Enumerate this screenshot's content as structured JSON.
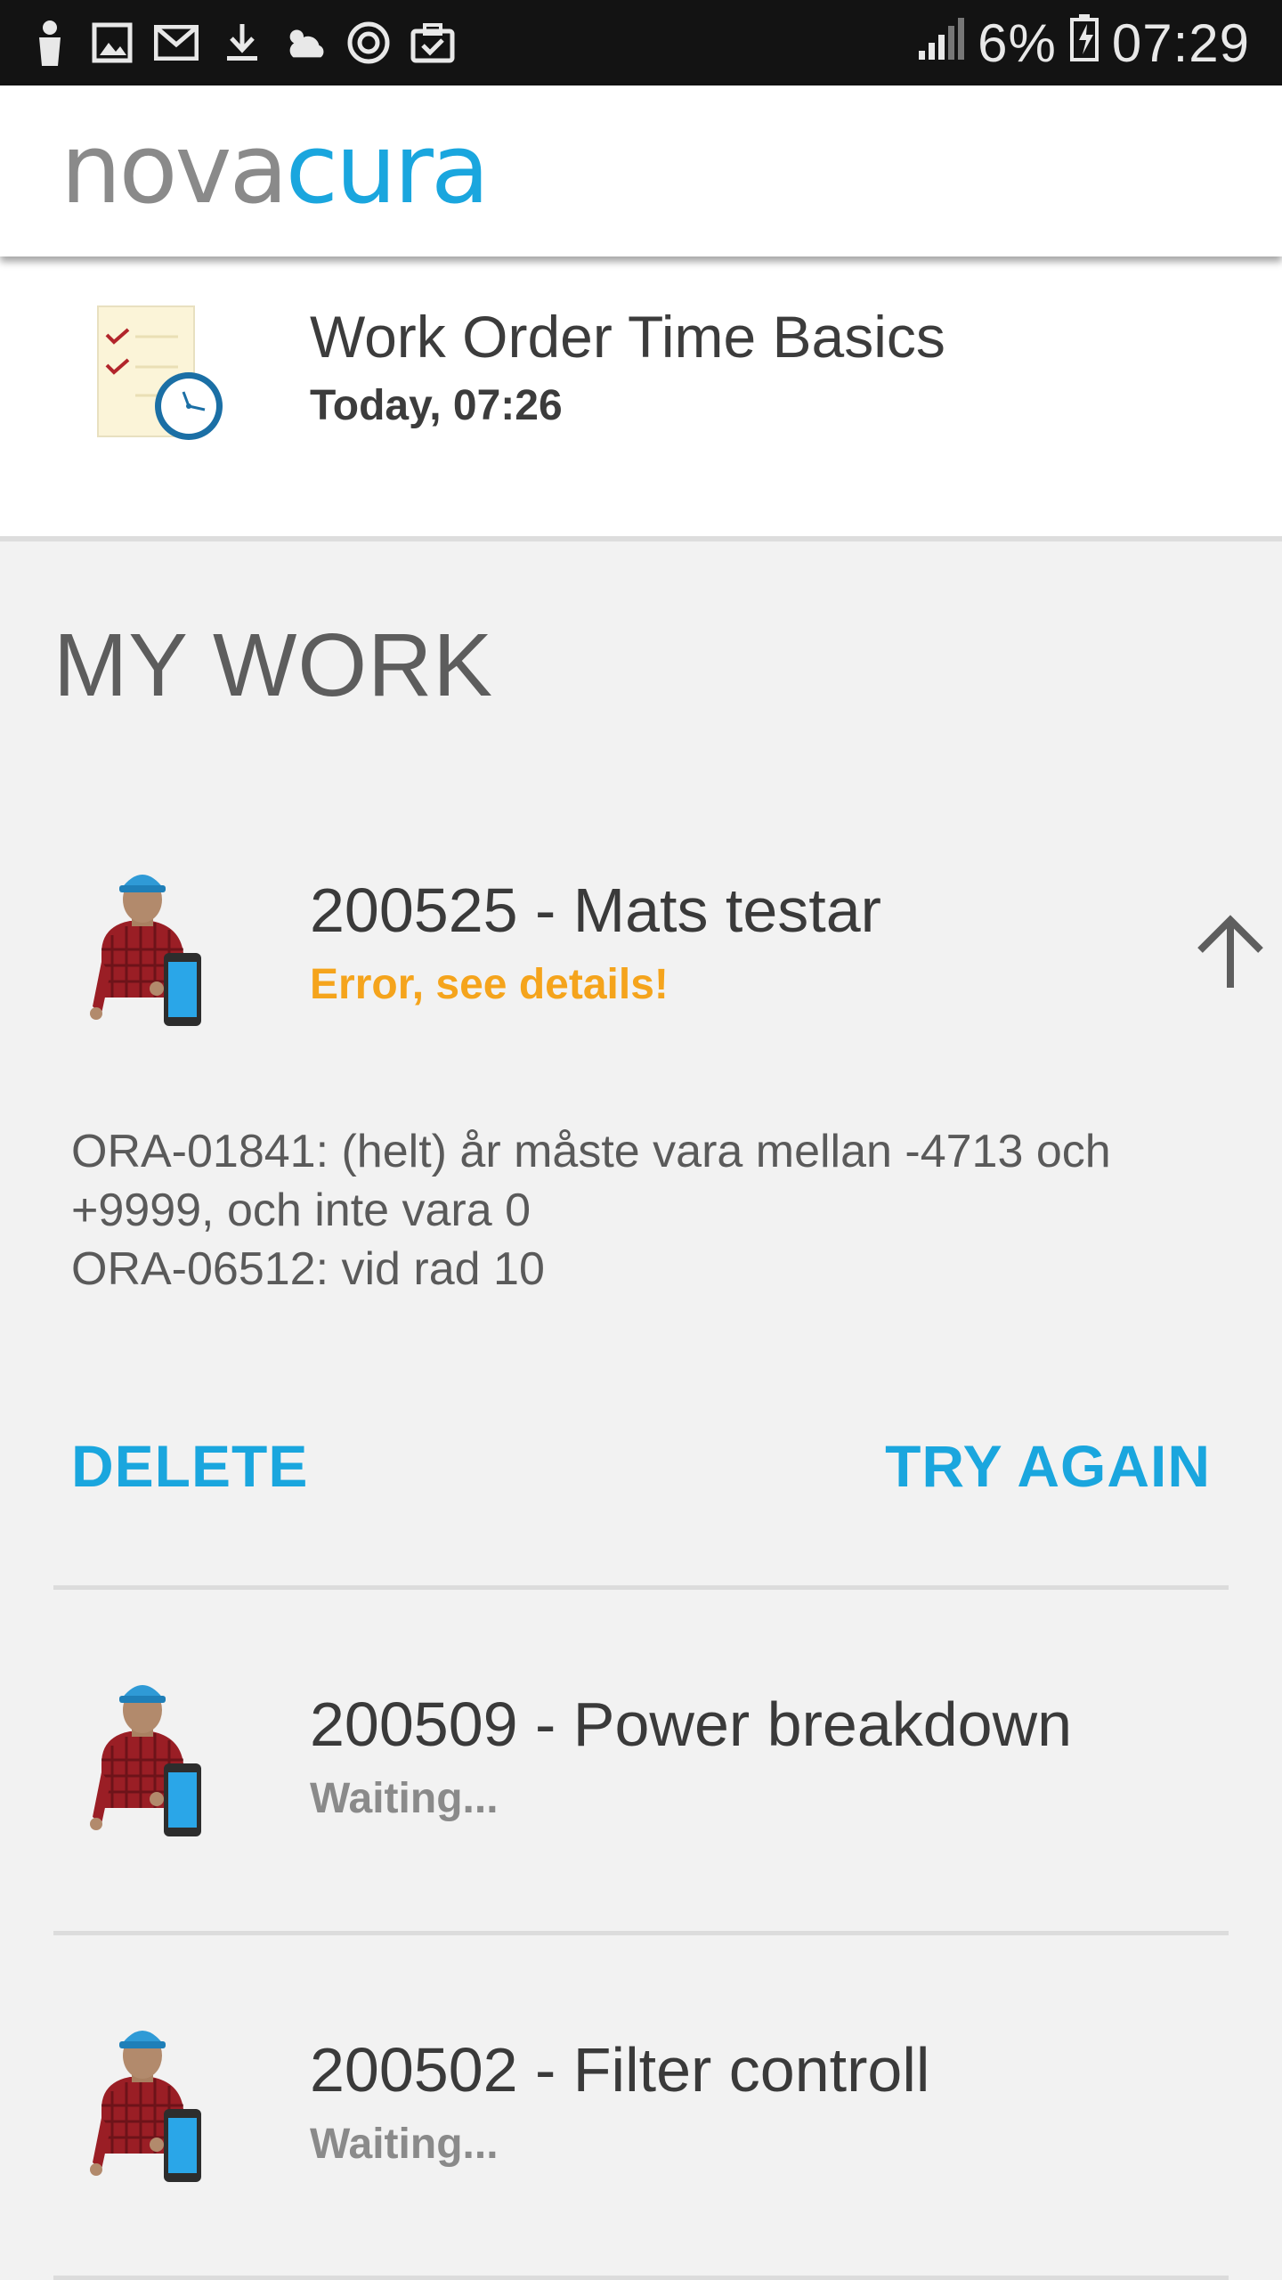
{
  "status_bar": {
    "battery": "6%",
    "time": "07:29"
  },
  "app": {
    "logo_part1": "nova",
    "logo_part2": "cura"
  },
  "workflow": {
    "title": "Work Order Time Basics",
    "subtitle": "Today, 07:26",
    "icon": "checklist-clock-icon"
  },
  "section": {
    "title": "MY WORK"
  },
  "work_items": [
    {
      "title": "200525 - Mats testar",
      "status": "Error, see details!",
      "status_type": "error",
      "error_lines": [
        "ORA-01841: (helt) år måste vara mellan -4713 och",
        "+9999, och inte vara 0",
        "ORA-06512: vid rad 10"
      ],
      "actions": {
        "delete": "DELETE",
        "try_again": "TRY AGAIN"
      }
    },
    {
      "title": "200509 - Power breakdown",
      "status": "Waiting...",
      "status_type": "waiting"
    },
    {
      "title": "200502 - Filter controll",
      "status": "Waiting...",
      "status_type": "waiting"
    }
  ],
  "colors": {
    "accent": "#1aa6de",
    "error": "#f5a41c",
    "waiting": "#8a8a8a"
  }
}
